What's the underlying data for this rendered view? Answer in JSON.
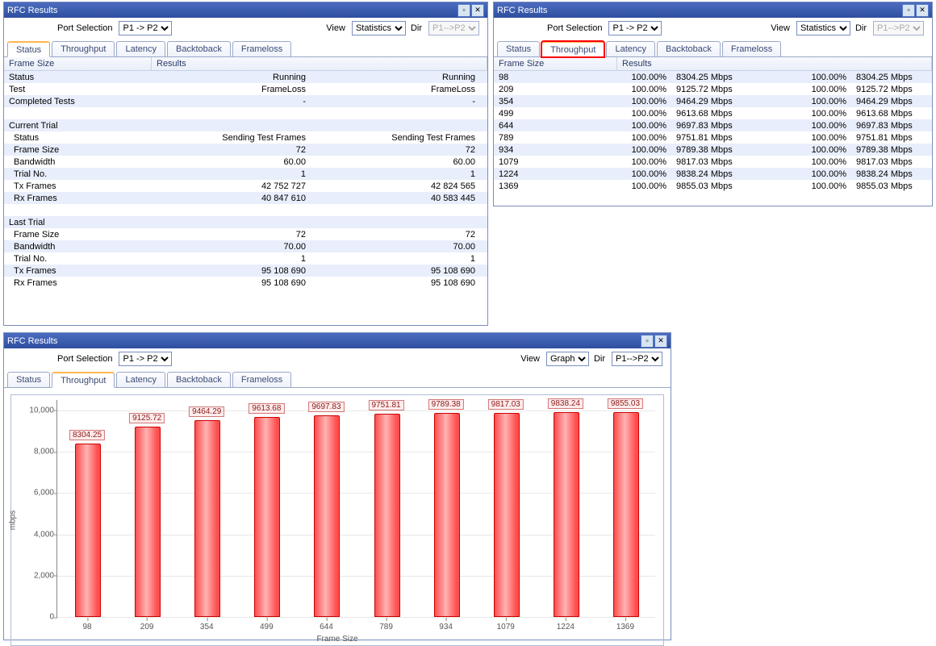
{
  "panels": {
    "p1": {
      "title": "RFC Results",
      "port_selection_label": "Port Selection",
      "port_selection_value": "P1 -> P2",
      "view_label": "View",
      "view_value": "Statistics",
      "dir_label": "Dir",
      "dir_value": "P1-->P2",
      "tabs": [
        "Status",
        "Throughput",
        "Latency",
        "Backtoback",
        "Frameloss"
      ],
      "active_tab": 0,
      "header": [
        "Frame Size",
        "Results"
      ],
      "rows": [
        {
          "label": "Status",
          "v1": "Running",
          "v2": "Running",
          "alt": true
        },
        {
          "label": "Test",
          "v1": "FrameLoss",
          "v2": "FrameLoss"
        },
        {
          "label": "Completed Tests",
          "v1": "-",
          "v2": "-",
          "alt": true
        },
        {
          "label": "",
          "v1": "",
          "v2": ""
        },
        {
          "label": "Current Trial",
          "v1": "",
          "v2": "",
          "alt": true
        },
        {
          "label": "Status",
          "indent": true,
          "v1": "Sending Test Frames",
          "v2": "Sending Test Frames"
        },
        {
          "label": "Frame Size",
          "indent": true,
          "v1": "72",
          "v2": "72",
          "alt": true
        },
        {
          "label": "Bandwidth",
          "indent": true,
          "v1": "60.00",
          "v2": "60.00"
        },
        {
          "label": "Trial No.",
          "indent": true,
          "v1": "1",
          "v2": "1",
          "alt": true
        },
        {
          "label": "Tx Frames",
          "indent": true,
          "v1": "42 752 727",
          "v2": "42 824 565"
        },
        {
          "label": "Rx Frames",
          "indent": true,
          "v1": "40 847 610",
          "v2": "40 583 445",
          "alt": true
        },
        {
          "label": "",
          "v1": "",
          "v2": ""
        },
        {
          "label": "Last Trial",
          "v1": "",
          "v2": "",
          "alt": true
        },
        {
          "label": "Frame Size",
          "indent": true,
          "v1": "72",
          "v2": "72"
        },
        {
          "label": "Bandwidth",
          "indent": true,
          "v1": "70.00",
          "v2": "70.00",
          "alt": true
        },
        {
          "label": "Trial No.",
          "indent": true,
          "v1": "1",
          "v2": "1"
        },
        {
          "label": "Tx Frames",
          "indent": true,
          "v1": "95 108 690",
          "v2": "95 108 690",
          "alt": true
        },
        {
          "label": "Rx Frames",
          "indent": true,
          "v1": "95 108 690",
          "v2": "95 108 690"
        }
      ]
    },
    "p2": {
      "title": "RFC Results",
      "port_selection_label": "Port Selection",
      "port_selection_value": "P1 -> P2",
      "view_label": "View",
      "view_value": "Statistics",
      "dir_label": "Dir",
      "dir_value": "P1-->P2",
      "tabs": [
        "Status",
        "Throughput",
        "Latency",
        "Backtoback",
        "Frameloss"
      ],
      "active_tab": 1,
      "header": [
        "Frame Size",
        "Results"
      ],
      "rows": [
        {
          "fs": "98",
          "pct1": "100.00%",
          "mbps1": "8304.25 Mbps",
          "pct2": "100.00%",
          "mbps2": "8304.25 Mbps",
          "alt": true
        },
        {
          "fs": "209",
          "pct1": "100.00%",
          "mbps1": "9125.72 Mbps",
          "pct2": "100.00%",
          "mbps2": "9125.72 Mbps"
        },
        {
          "fs": "354",
          "pct1": "100.00%",
          "mbps1": "9464.29 Mbps",
          "pct2": "100.00%",
          "mbps2": "9464.29 Mbps",
          "alt": true
        },
        {
          "fs": "499",
          "pct1": "100.00%",
          "mbps1": "9613.68 Mbps",
          "pct2": "100.00%",
          "mbps2": "9613.68 Mbps"
        },
        {
          "fs": "644",
          "pct1": "100.00%",
          "mbps1": "9697.83 Mbps",
          "pct2": "100.00%",
          "mbps2": "9697.83 Mbps",
          "alt": true
        },
        {
          "fs": "789",
          "pct1": "100.00%",
          "mbps1": "9751.81 Mbps",
          "pct2": "100.00%",
          "mbps2": "9751.81 Mbps"
        },
        {
          "fs": "934",
          "pct1": "100.00%",
          "mbps1": "9789.38 Mbps",
          "pct2": "100.00%",
          "mbps2": "9789.38 Mbps",
          "alt": true
        },
        {
          "fs": "1079",
          "pct1": "100.00%",
          "mbps1": "9817.03 Mbps",
          "pct2": "100.00%",
          "mbps2": "9817.03 Mbps"
        },
        {
          "fs": "1224",
          "pct1": "100.00%",
          "mbps1": "9838.24 Mbps",
          "pct2": "100.00%",
          "mbps2": "9838.24 Mbps",
          "alt": true
        },
        {
          "fs": "1369",
          "pct1": "100.00%",
          "mbps1": "9855.03 Mbps",
          "pct2": "100.00%",
          "mbps2": "9855.03 Mbps"
        }
      ]
    },
    "p3": {
      "title": "RFC Results",
      "port_selection_label": "Port Selection",
      "port_selection_value": "P1 -> P2",
      "view_label": "View",
      "view_value": "Graph",
      "dir_label": "Dir",
      "dir_value": "P1-->P2",
      "tabs": [
        "Status",
        "Throughput",
        "Latency",
        "Backtoback",
        "Frameloss"
      ],
      "active_tab": 1
    }
  },
  "icons": {
    "pin": "▫",
    "close": "✕"
  },
  "chart_data": {
    "type": "bar",
    "categories": [
      "98",
      "209",
      "354",
      "499",
      "644",
      "789",
      "934",
      "1079",
      "1224",
      "1369"
    ],
    "values": [
      8304.25,
      9125.72,
      9464.29,
      9613.68,
      9697.83,
      9751.81,
      9789.38,
      9817.03,
      9838.24,
      9855.03
    ],
    "title": "",
    "xlabel": "Frame Size",
    "ylabel": "mbps",
    "yticks": [
      0,
      2000,
      4000,
      6000,
      8000,
      10000
    ],
    "ylim": [
      0,
      10500
    ]
  }
}
